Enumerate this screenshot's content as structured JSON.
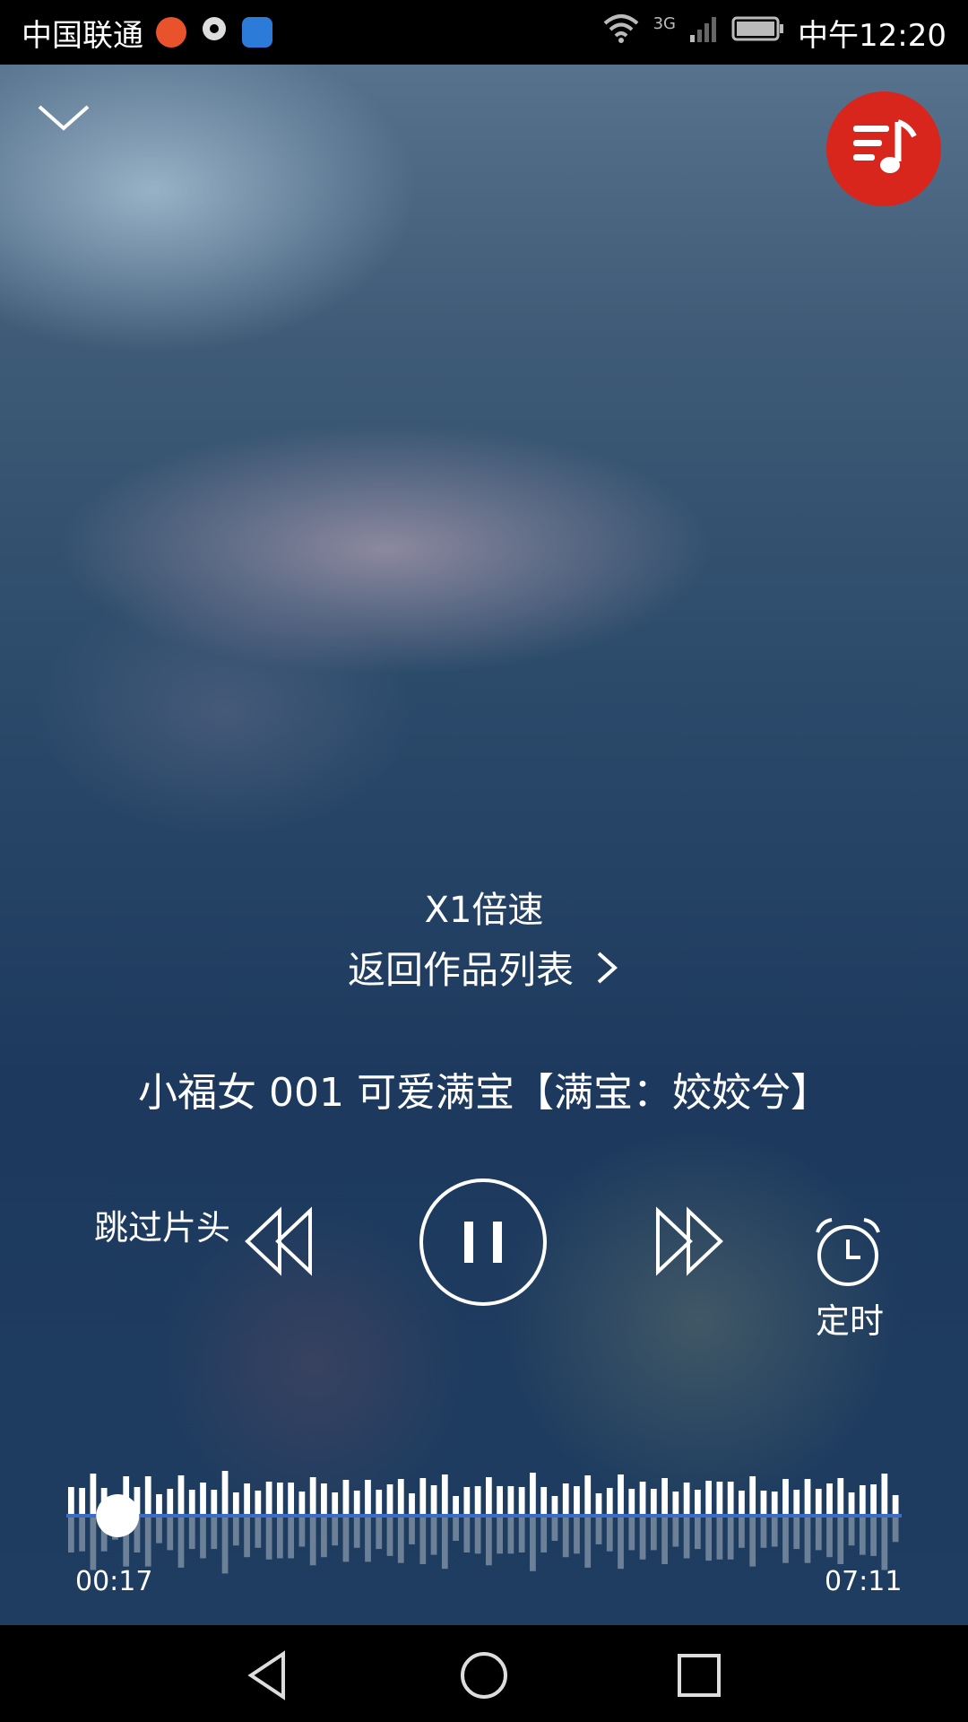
{
  "status_bar": {
    "carrier": "中国联通",
    "network": "3G",
    "time": "中午12:20",
    "icons": [
      "app-notification-icon",
      "record-icon",
      "heart-message-icon",
      "wifi-icon",
      "signal-icon",
      "battery-icon"
    ]
  },
  "player": {
    "speed_label": "X1倍速",
    "back_to_list_label": "返回作品列表",
    "track_title": "小福女 001 可爱满宝【满宝：姣姣兮】",
    "skip_intro_label": "跳过片头",
    "timer_label": "定时",
    "current_time": "00:17",
    "total_time": "07:11",
    "progress": 0.04,
    "state": "playing"
  },
  "colors": {
    "accent": "#d8261c",
    "progress_line": "#3b6cc7",
    "text": "#ffffff"
  },
  "icons": {
    "collapse": "chevron-down-icon",
    "playlist": "music-list-icon",
    "rewind": "rewind-icon",
    "pause": "pause-icon",
    "forward": "fast-forward-icon",
    "timer": "alarm-clock-icon"
  }
}
